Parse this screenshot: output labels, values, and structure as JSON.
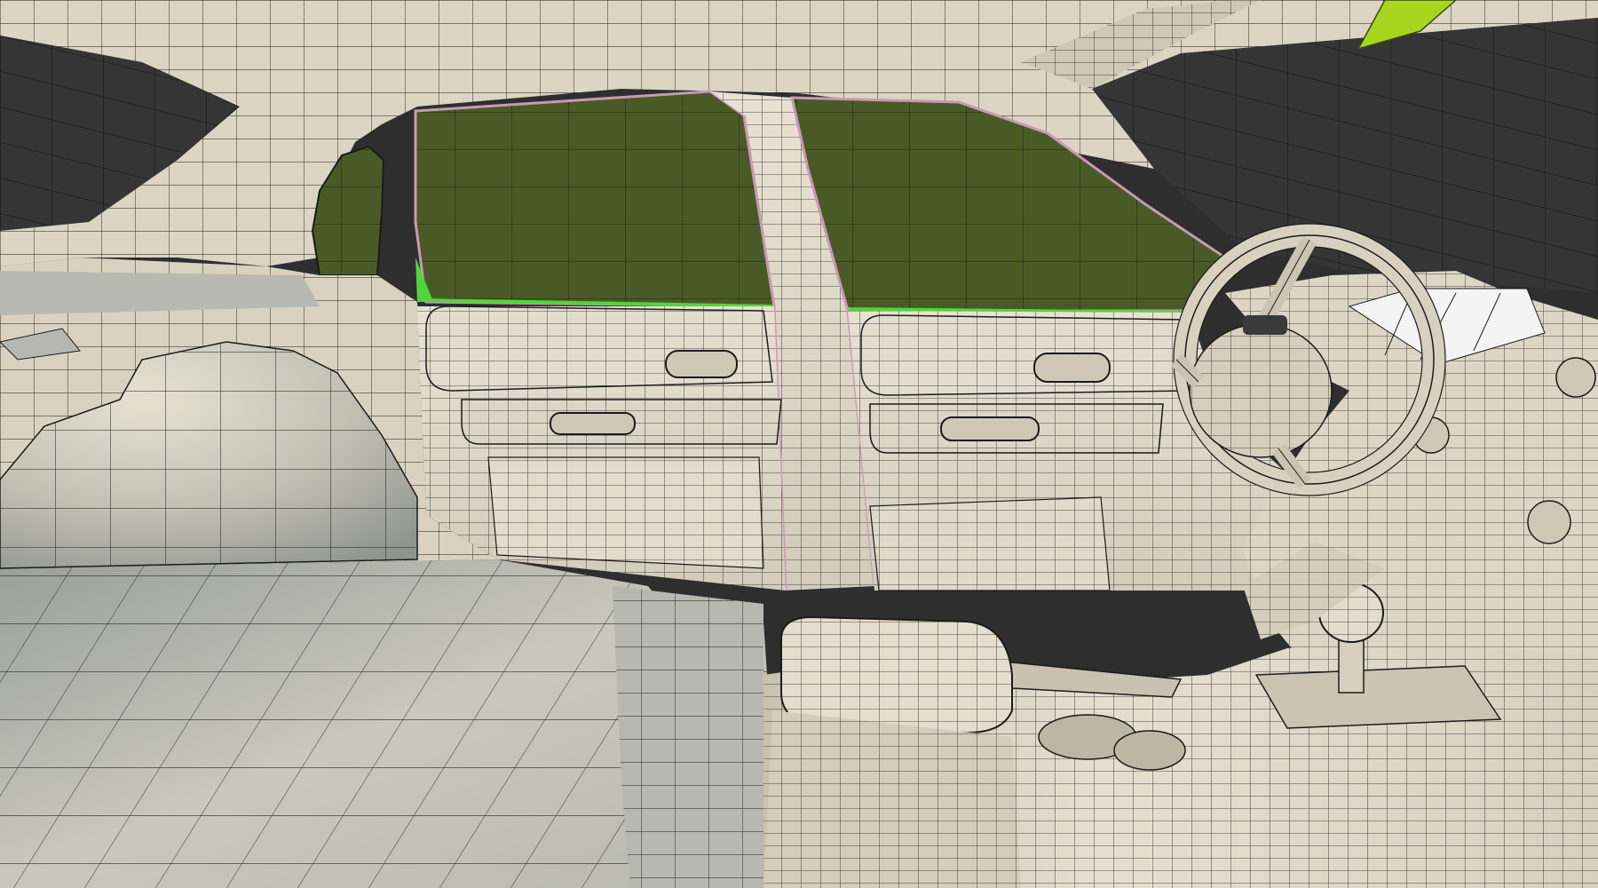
{
  "viewport": {
    "label": "",
    "render_mode": "solid-with-wireframe",
    "subject": "car-interior-mesh"
  },
  "colors": {
    "void": "#2e2e2e",
    "surface_light": "#e7e0d1",
    "surface_mid": "#d2cbb9",
    "surface_shadow": "#9da09a",
    "floor": "#8f958f",
    "wire": "#1b1b1b",
    "glass": "#4a5a26",
    "glass_selected_edge": "#4fd63a",
    "seam_highlight": "#c79ab4",
    "mirror_accent": "#a8d61f",
    "windshield_bright": "#f4f4f4"
  },
  "components": [
    {
      "id": "headliner",
      "icon": "roof-shape"
    },
    {
      "id": "rear-quarter-window",
      "icon": "glass-shape"
    },
    {
      "id": "rear-door-window",
      "icon": "glass-shape"
    },
    {
      "id": "front-door-window",
      "icon": "glass-shape"
    },
    {
      "id": "b-pillar",
      "icon": "pillar-shape"
    },
    {
      "id": "rear-door-panel",
      "icon": "door-panel-shape"
    },
    {
      "id": "front-door-panel",
      "icon": "door-panel-shape"
    },
    {
      "id": "steering-wheel",
      "icon": "wheel-shape"
    },
    {
      "id": "dashboard",
      "icon": "dash-shape"
    },
    {
      "id": "center-console",
      "icon": "console-shape"
    },
    {
      "id": "gear-shifter",
      "icon": "knob-shape"
    },
    {
      "id": "armrest",
      "icon": "cushion-shape"
    },
    {
      "id": "rear-seat-back",
      "icon": "seat-shape"
    },
    {
      "id": "floor",
      "icon": "floor-shape"
    },
    {
      "id": "rearview-mirror",
      "icon": "mirror-shape"
    }
  ]
}
